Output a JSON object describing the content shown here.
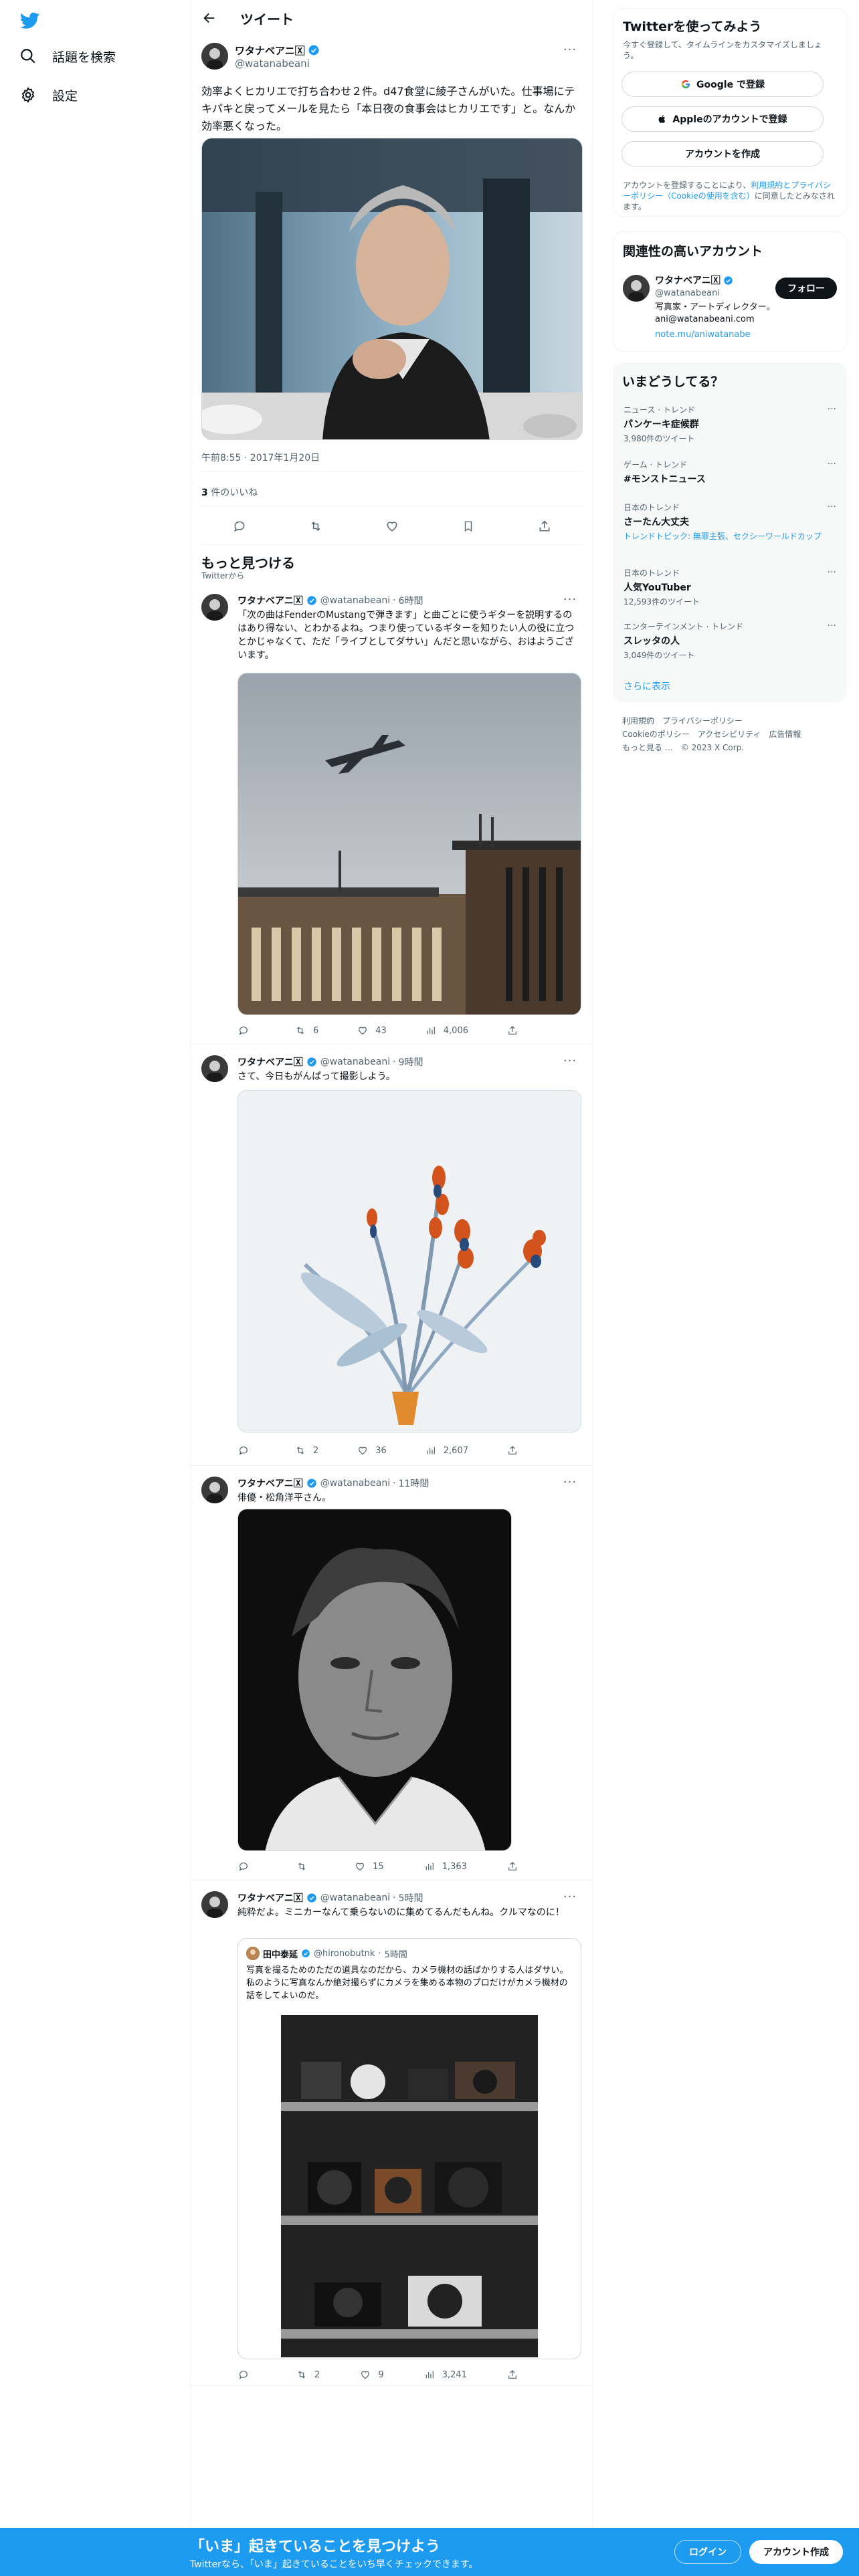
{
  "nav": {
    "explore_label": "話題を検索",
    "settings_label": "設定"
  },
  "header": {
    "title": "ツイート"
  },
  "main_tweet": {
    "name": "ワタナベアニ🅇",
    "handle": "@watanabeani",
    "text": "効率よくヒカリエで打ち合わせ２件。d47食堂に綾子さんがいた。仕事場にテキパキと戻ってメールを見たら「本日夜の食事会はヒカリエです」と。なんか効率悪くなった。",
    "timestamp": "午前8:55 · 2017年1月20日",
    "likes_count": "3",
    "likes_label": " 件のいいね"
  },
  "more_section": {
    "title": "もっと見つける",
    "subtitle": "Twitterから"
  },
  "feed": [
    {
      "name": "ワタナベアニ🅇",
      "handle": "@watanabeani",
      "time": "6時間",
      "text": "「次の曲はFenderのMustangで弾きます」と曲ごとに使うギターを説明するのはあり得ない、とわかるよね。つまり使っているギターを知りたい人の役に立つとかじゃなくて、ただ「ライブとしてダサい」んだと思いながら、おはようございます。",
      "replies": "",
      "retweets": "6",
      "likes": "43",
      "views": "4,006"
    },
    {
      "name": "ワタナベアニ🅇",
      "handle": "@watanabeani",
      "time": "9時間",
      "text": "さて、今日もがんばって撮影しよう。",
      "replies": "",
      "retweets": "2",
      "likes": "36",
      "views": "2,607"
    },
    {
      "name": "ワタナベアニ🅇",
      "handle": "@watanabeani",
      "time": "11時間",
      "text": "俳優・松角洋平さん。",
      "replies": "",
      "retweets": "",
      "likes": "15",
      "views": "1,363"
    },
    {
      "name": "ワタナベアニ🅇",
      "handle": "@watanabeani",
      "time": "5時間",
      "text": "純粋だよ。ミニカーなんて乗らないのに集めてるんだもんね。クルマなのに！",
      "quote": {
        "name": "田中泰延",
        "handle": "@hironobutnk",
        "time": "5時間",
        "text": "写真を撮るためのただの道具なのだから、カメラ機材の話ばかりする人はダサい。私のように写真なんか絶対撮らずにカメラを集める本物のプロだけがカメラ機材の話をしてよいのだ。"
      },
      "replies": "",
      "retweets": "2",
      "likes": "9",
      "views": "3,241"
    }
  ],
  "signup": {
    "title": "Twitterを使ってみよう",
    "subtitle": "今すぐ登録して、タイムラインをカスタマイズしましょう。",
    "google_label": "Google で登録",
    "apple_label": "Appleのアカウントで登録",
    "create_label": "アカウントを作成",
    "terms_prefix": "アカウントを登録することにより、",
    "terms_link": "利用規約とプライバシーポリシー（Cookieの使用を含む）",
    "terms_suffix": "に同意したとみなされます。"
  },
  "relevant": {
    "title": "関連性の高いアカウント",
    "name": "ワタナベアニ🅇",
    "handle": "@watanabeani",
    "bio": "写真家・アートディレクター。 ani@watanabeani.com",
    "link": "note.mu/aniwatanabe",
    "follow_label": "フォロー"
  },
  "trends": {
    "title": "いまどうしてる？",
    "items": [
      {
        "category": "ニュース · トレンド",
        "title": "パンケーキ症候群",
        "count": "3,980件のツイート"
      },
      {
        "category": "ゲーム · トレンド",
        "title": "#モンストニュース",
        "count": ""
      },
      {
        "category": "日本のトレンド",
        "title": "さーたん大丈夫",
        "count": "トレンドトピック: 無罪主張、セクシーワールドカップ"
      },
      {
        "category": "日本のトレンド",
        "title": "人気YouTuber",
        "count": "12,593件のツイート"
      },
      {
        "category": "エンターテインメント · トレンド",
        "title": "スレッタの人",
        "count": "3,049件のツイート"
      }
    ],
    "show_more": "さらに表示"
  },
  "footer": {
    "line1": "利用規約　プライバシーポリシー",
    "line2": "Cookieのポリシー　アクセシビリティ　広告情報",
    "line3": "もっと見る …　© 2023 X Corp."
  },
  "bottom_bar": {
    "title": "「いま」起きていることを見つけよう",
    "subtitle": "Twitterなら、「いま」起きていることをいち早くチェックできます。",
    "login_label": "ログイン",
    "signup_label": "アカウント作成"
  },
  "colors": {
    "accent": "#1d9bf0",
    "text": "#0f1419",
    "secondary": "#536471"
  }
}
